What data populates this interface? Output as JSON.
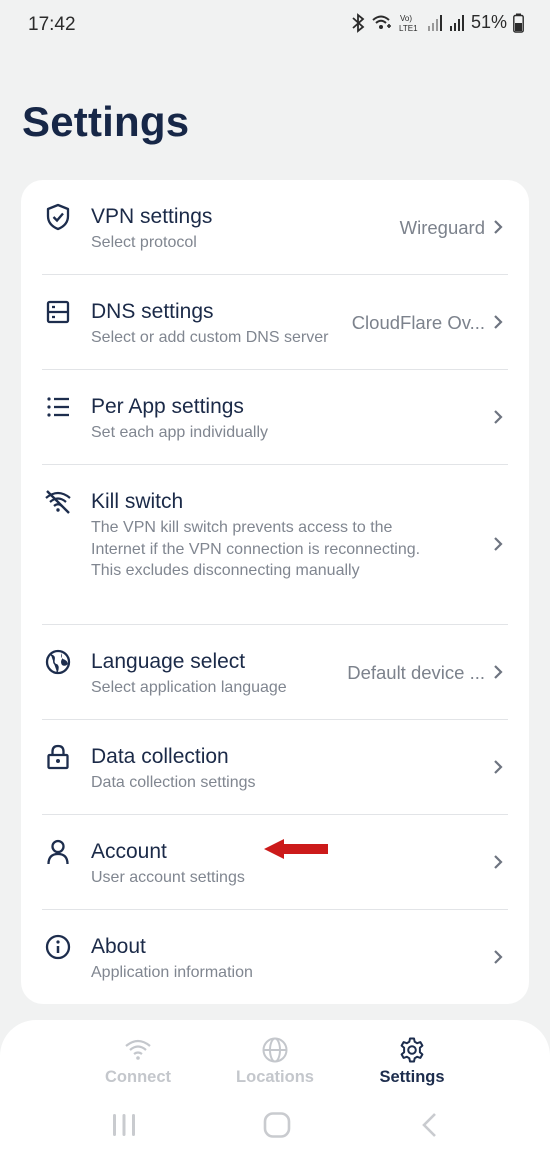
{
  "status_bar": {
    "time": "17:42",
    "battery": "51%",
    "icons": [
      "bluetooth-icon",
      "wifi-calling-icon",
      "volte-icon",
      "signal-icon",
      "signal-icon",
      "battery-icon"
    ]
  },
  "page": {
    "title": "Settings"
  },
  "settings": [
    {
      "icon": "shield-check-icon",
      "title": "VPN settings",
      "subtitle": "Select protocol",
      "value": "Wireguard"
    },
    {
      "icon": "server-icon",
      "title": "DNS settings",
      "subtitle": "Select or add custom DNS server",
      "value": "CloudFlare Ov..."
    },
    {
      "icon": "list-icon",
      "title": "Per App settings",
      "subtitle": "Set each app individually",
      "value": ""
    },
    {
      "icon": "wifi-off-icon",
      "title": "Kill switch",
      "subtitle": "The VPN kill switch prevents access to the Internet if the VPN connection is reconnecting. This excludes disconnecting manually",
      "value": ""
    },
    {
      "icon": "globe-icon",
      "title": "Language select",
      "subtitle": "Select application language",
      "value": "Default device ..."
    },
    {
      "icon": "lock-icon",
      "title": "Data collection",
      "subtitle": "Data collection settings",
      "value": ""
    },
    {
      "icon": "user-icon",
      "title": "Account",
      "subtitle": "User account settings",
      "value": ""
    },
    {
      "icon": "info-icon",
      "title": "About",
      "subtitle": "Application information",
      "value": ""
    }
  ],
  "annotation": {
    "color": "#cc1a1a"
  },
  "bottom_nav": [
    {
      "icon": "wifi-icon",
      "label": "Connect",
      "active": false
    },
    {
      "icon": "globe-icon",
      "label": "Locations",
      "active": false
    },
    {
      "icon": "gear-icon",
      "label": "Settings",
      "active": true
    }
  ],
  "colors": {
    "background": "#f1f2f2",
    "title": "#172747",
    "accent": "#1d2d4d",
    "muted": "#808690"
  }
}
